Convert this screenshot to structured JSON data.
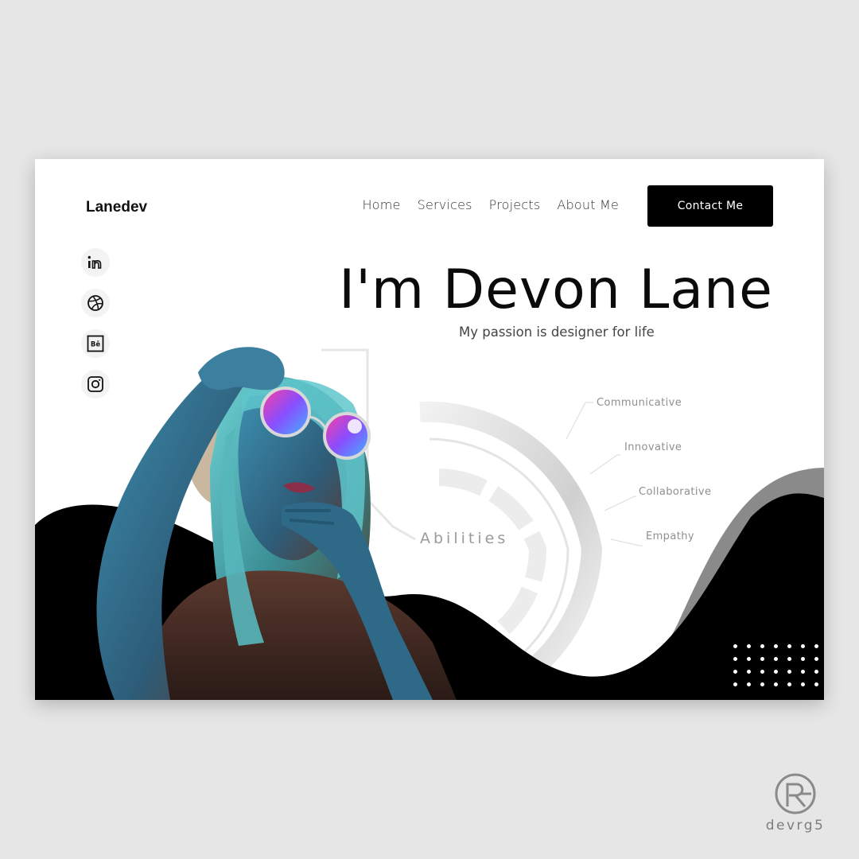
{
  "brand": {
    "logo": "Lanedev"
  },
  "nav": {
    "items": [
      "Home",
      "Services",
      "Projects",
      "About Me"
    ],
    "cta": "Contact Me"
  },
  "socials": [
    "linkedin-icon",
    "dribbble-icon",
    "behance-icon",
    "instagram-icon"
  ],
  "hero": {
    "title": "I'm Devon Lane",
    "subtitle": "My passion is designer for life"
  },
  "abilities": {
    "title": "Abilities",
    "items": [
      "Communicative",
      "Innovative",
      "Collaborative",
      "Empathy"
    ]
  },
  "watermark": {
    "text": "devrg5"
  },
  "colors": {
    "background": "#e6e6e6",
    "card": "#ffffff",
    "primary": "#000000",
    "accent_gray": "#8a8a8a"
  }
}
